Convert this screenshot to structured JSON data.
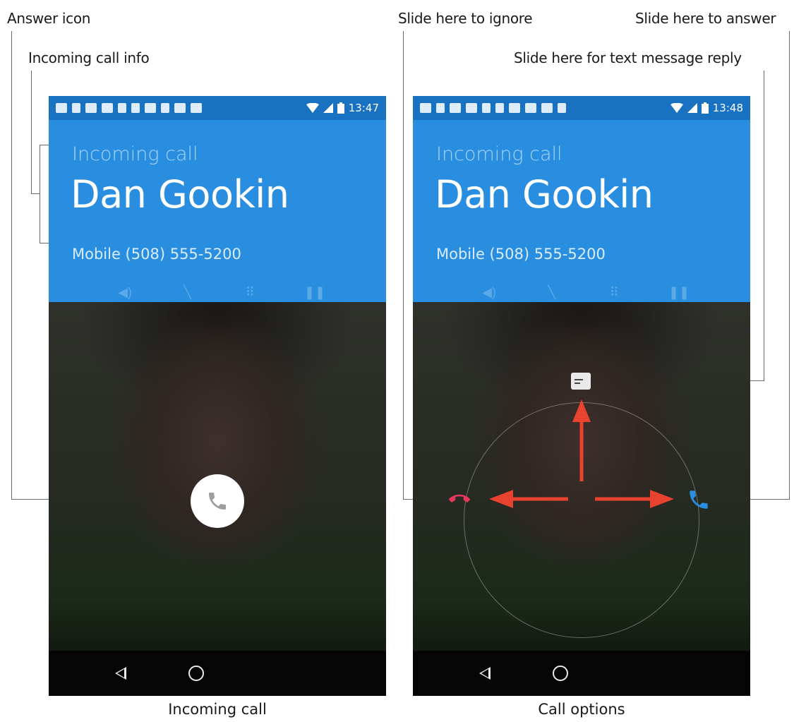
{
  "callouts": {
    "answer_icon": "Answer icon",
    "incoming_call_info": "Incoming call info",
    "slide_ignore": "Slide here to ignore",
    "slide_answer": "Slide here to answer",
    "slide_text": "Slide here for text message reply"
  },
  "captions": {
    "left": "Incoming call",
    "right": "Call options"
  },
  "screens": [
    {
      "status_time": "13:47",
      "incoming_label": "Incoming call",
      "caller_name": "Dan Gookin",
      "caller_number": "Mobile (508) 555-5200"
    },
    {
      "status_time": "13:48",
      "incoming_label": "Incoming call",
      "caller_name": "Dan Gookin",
      "caller_number": "Mobile (508) 555-5200"
    }
  ],
  "icons": {
    "controls": [
      "speaker-icon",
      "mute-icon",
      "dialpad-icon",
      "hold-icon"
    ],
    "answer": "phone-icon",
    "ignore": "hang-up-icon",
    "text_reply": "message-icon",
    "nav": [
      "back-icon",
      "home-icon"
    ]
  },
  "colors": {
    "status_bar": "#1971c2",
    "header": "#2a8ee0",
    "arrow": "#e8432e",
    "ignore_icon": "#e8375a",
    "answer_icon": "#2a8ee0"
  }
}
